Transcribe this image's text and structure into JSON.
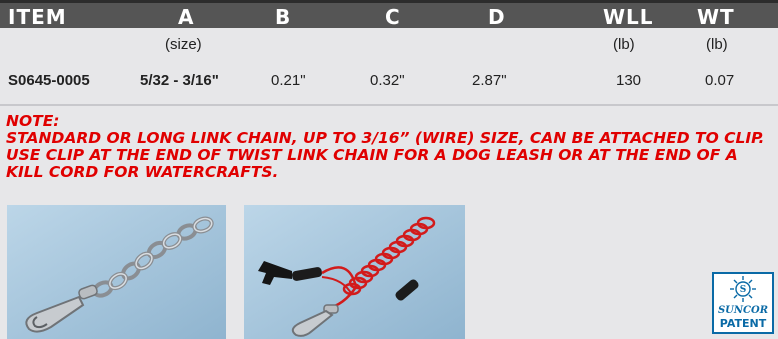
{
  "header": {
    "item": "ITEM",
    "a": "A",
    "b": "B",
    "c": "C",
    "d": "D",
    "wll": "WLL",
    "wt": "WT"
  },
  "units": {
    "a": "(size)",
    "wll": "(lb)",
    "wt": "(lb)"
  },
  "row": {
    "item": "S0645-0005",
    "a": "5/32 - 3/16\"",
    "b": "0.21\"",
    "c": "0.32\"",
    "d": "2.87\"",
    "wll": "130",
    "wt": "0.07"
  },
  "note": {
    "title": "NOTE:",
    "body": "STANDARD OR LONG LINK CHAIN, UP TO 3/16” (WIRE) SIZE, CAN BE ATTACHED TO CLIP. USE CLIP AT THE END OF TWIST LINK CHAIN FOR A DOG LEASH OR AT THE END OF A KILL CORD FOR WATERCRAFTS."
  },
  "logo": {
    "brand": "SUNCOR",
    "tag": "PATENT"
  },
  "colors": {
    "header_bg": "#555555",
    "note_red": "#e00000",
    "photo_bg": "#a9c9de",
    "logo_blue": "#0a6aa6"
  }
}
